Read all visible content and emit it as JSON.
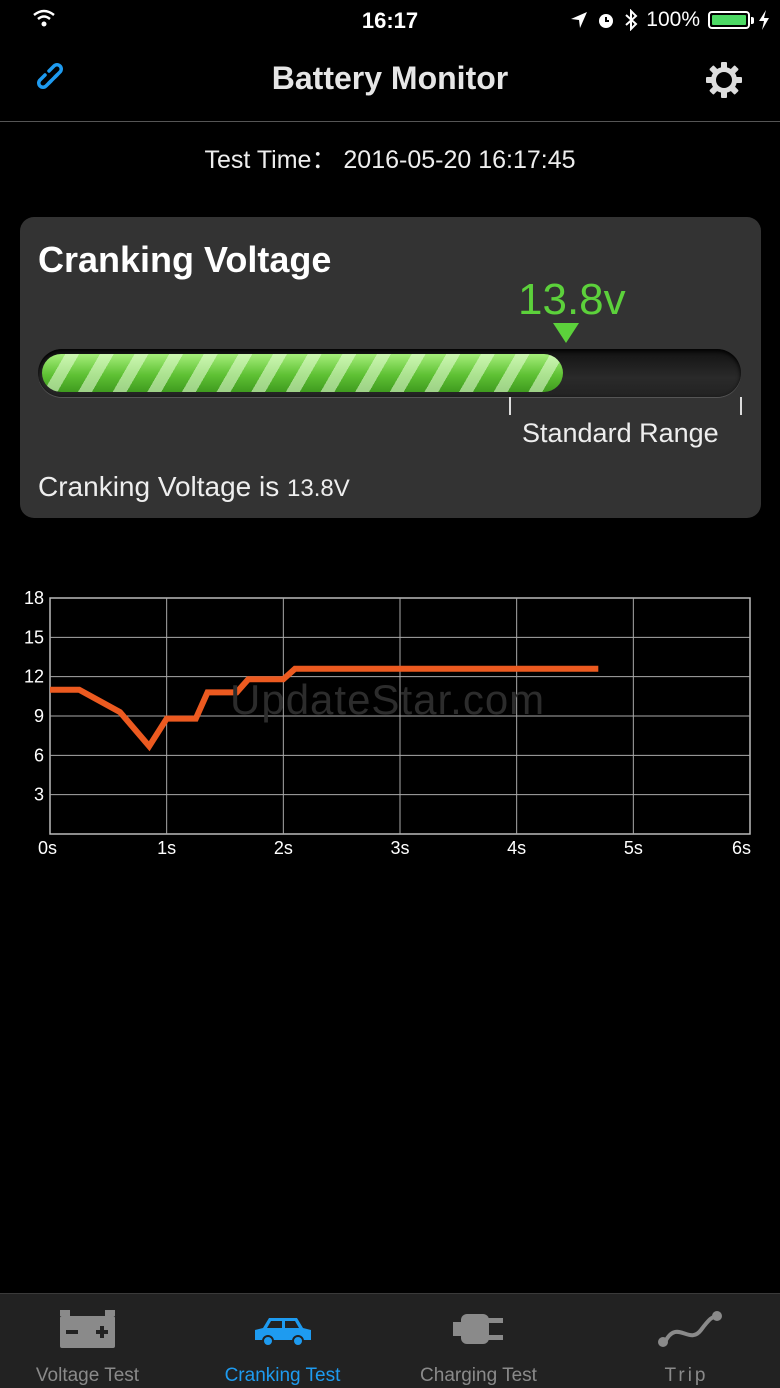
{
  "status_bar": {
    "time": "16:17",
    "battery_percent": "100%"
  },
  "nav": {
    "title": "Battery Monitor"
  },
  "test_time": "Test Time： 2016-05-20 16:17:45",
  "card": {
    "title": "Cranking Voltage",
    "value_display": "13.8v",
    "level_fraction": 0.75,
    "range_label": "Standard Range",
    "status_prefix": "Cranking Voltage is ",
    "status_value": "13.8V",
    "accent_color": "#5cd13b"
  },
  "watermark": "UpdateStar.com",
  "chart_data": {
    "type": "line",
    "title": "",
    "xlabel": "",
    "ylabel": "",
    "xlim": [
      0,
      6
    ],
    "ylim": [
      0,
      18
    ],
    "x_ticks": [
      "0s",
      "1s",
      "2s",
      "3s",
      "4s",
      "5s",
      "6s"
    ],
    "y_ticks": [
      "3",
      "6",
      "9",
      "12",
      "15",
      "18"
    ],
    "grid": true,
    "series": [
      {
        "color": "#ec5a20",
        "x": [
          0,
          0.25,
          0.6,
          0.85,
          1.0,
          1.25,
          1.35,
          1.6,
          1.7,
          1.75,
          2.0,
          2.1,
          4.7
        ],
        "y": [
          11.0,
          11.0,
          9.3,
          6.7,
          8.8,
          8.8,
          10.8,
          10.8,
          11.8,
          11.8,
          11.8,
          12.6,
          12.6
        ]
      }
    ]
  },
  "tabs": [
    {
      "label": "Voltage Test",
      "icon": "car-battery-icon"
    },
    {
      "label": "Cranking Test",
      "icon": "car-icon",
      "active": true
    },
    {
      "label": "Charging Test",
      "icon": "plug-icon"
    },
    {
      "label": "Trip",
      "icon": "route-icon"
    }
  ]
}
